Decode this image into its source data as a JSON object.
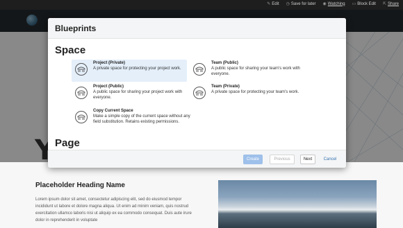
{
  "topbar": {
    "items": [
      {
        "icon": "pencil-icon",
        "label": "Edit"
      },
      {
        "icon": "clock-icon",
        "label": "Save for later"
      },
      {
        "icon": "eye-icon",
        "label": "Watching"
      },
      {
        "icon": "block-icon",
        "label": "Block Edit"
      },
      {
        "icon": "share-icon",
        "label": "Share"
      }
    ]
  },
  "hero": {
    "letter": "Y"
  },
  "page": {
    "heading": "Placeholder Heading Name",
    "body": "Lorem ipsum dolor sit amet, consectetur adipiscing elit, sed do eiusmod tempor incididunt ut labore et dolore magna aliqua. Ut enim ad minim veniam, quis nostrud exercitation ullamco laboris nisi ut aliquip ex ea commodo consequat. Duis aute irure dolor in reprehenderit in voluptate"
  },
  "modal": {
    "title": "Blueprints",
    "sections": {
      "space": "Space",
      "page": "Page"
    },
    "blueprints": [
      {
        "name": "Project (Private)",
        "desc": "A private space for protecting your project work.",
        "selected": true
      },
      {
        "name": "Team (Public)",
        "desc": "A public space for sharing your team's work with everyone.",
        "selected": false
      },
      {
        "name": "Project (Public)",
        "desc": "A public space for sharing your project work with everyone.",
        "selected": false
      },
      {
        "name": "Team (Private)",
        "desc": "A private space for protecting your team's work.",
        "selected": false
      },
      {
        "name": "Copy Current Space",
        "desc": "Make a simple copy of the current space without any field substitution. Retains existing permissions.",
        "selected": false
      }
    ],
    "footer": {
      "create": "Create",
      "previous": "Previous",
      "next": "Next",
      "cancel": "Cancel"
    }
  },
  "colors": {
    "accent": "#3572b0",
    "selected_bg": "#e4effa",
    "create_disabled": "#9ec0ea"
  }
}
